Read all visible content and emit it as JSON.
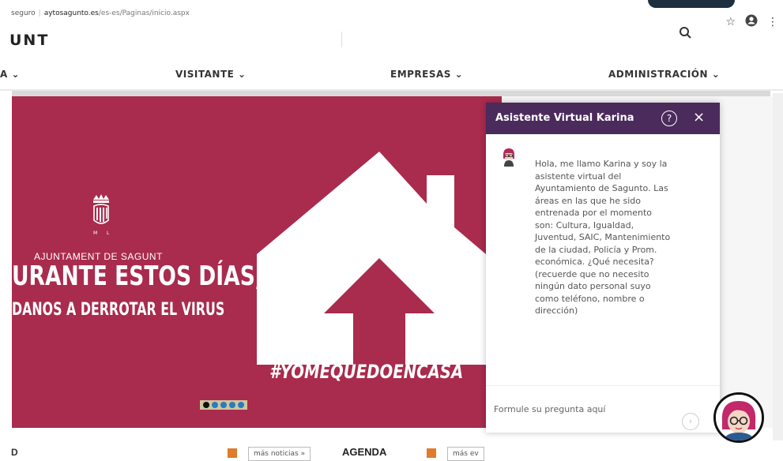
{
  "browser": {
    "url_prefix": "seguro",
    "url_domain": "aytosagunto.es",
    "url_path": "/es-es/Paginas/inicio.aspx"
  },
  "site": {
    "brand": "UNT"
  },
  "nav": {
    "items": [
      {
        "label": "A ⌄"
      },
      {
        "label": "VISITANTE ⌄"
      },
      {
        "label": "EMPRESAS ⌄"
      },
      {
        "label": "ADMINISTRACIÓN ⌄"
      }
    ]
  },
  "banner": {
    "ajuntament": "AJUNTAMENT DE SAGUNT",
    "headline1": "URANTE ESTOS DÍAS,",
    "headline2": "DANOS A DERROTAR EL VIRUS",
    "hashtag": "#YOMEQUEDOENCASA",
    "background_color": "#a92b4d",
    "slide_count": 5,
    "active_slide": 1
  },
  "bottom": {
    "left_label": "D",
    "more_news": "más noticias »",
    "agenda_title": "AGENDA",
    "more_events": "más ev"
  },
  "chat": {
    "title": "Asistente Virtual Karina",
    "help_symbol": "?",
    "close_symbol": "×",
    "message": "Hola, me llamo Karina y soy la asistente virtual del Ayuntamiento de Sagunto. Las áreas en las que he sido entrenada por el momento son: Cultura, Igualdad, Juventud, SAIC, Mantenimiento de la ciudad, Policía y Prom. económica. ¿Qué necesita? (recuerde que no necesito ningún dato personal suyo como teléfono, nombre o dirección)",
    "input_placeholder": "Formule su pregunta aquí",
    "header_color": "#4b2a5c"
  },
  "icons": {
    "search": "search-icon",
    "star": "star-icon",
    "account": "account-icon",
    "menu": "kebab-menu-icon",
    "send": "send-icon",
    "avatar": "avatar-icon"
  }
}
